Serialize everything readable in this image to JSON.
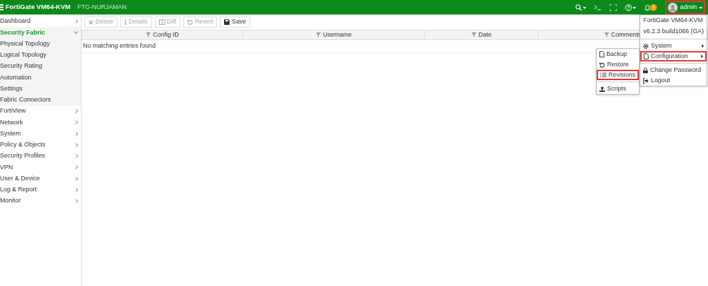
{
  "header": {
    "product": "FortiGate VM64-KVM",
    "hostname": "FTG-NURJAMAN",
    "notification_count": "1",
    "user": "admin",
    "user_highlighted": true
  },
  "sidebar": {
    "items": [
      {
        "label": "Dashboard",
        "expanded": false,
        "selected": false
      },
      {
        "label": "Security Fabric",
        "expanded": true,
        "selected": true,
        "children": [
          {
            "label": "Physical Topology"
          },
          {
            "label": "Logical Topology"
          },
          {
            "label": "Security Rating"
          },
          {
            "label": "Automation"
          },
          {
            "label": "Settings"
          },
          {
            "label": "Fabric Connectors"
          }
        ]
      },
      {
        "label": "FortiView",
        "expanded": false,
        "selected": false
      },
      {
        "label": "Network",
        "expanded": false,
        "selected": false
      },
      {
        "label": "System",
        "expanded": false,
        "selected": false
      },
      {
        "label": "Policy & Objects",
        "expanded": false,
        "selected": false
      },
      {
        "label": "Security Profiles",
        "expanded": false,
        "selected": false
      },
      {
        "label": "VPN",
        "expanded": false,
        "selected": false
      },
      {
        "label": "User & Device",
        "expanded": false,
        "selected": false
      },
      {
        "label": "Log & Report",
        "expanded": false,
        "selected": false
      },
      {
        "label": "Monitor",
        "expanded": false,
        "selected": false
      }
    ]
  },
  "toolbar": [
    {
      "kind": "delete",
      "label": "Delete",
      "disabled": true
    },
    {
      "kind": "details",
      "label": "Details",
      "disabled": true
    },
    {
      "kind": "diff",
      "label": "Diff",
      "disabled": true
    },
    {
      "kind": "revert",
      "label": "Revert",
      "disabled": true
    },
    {
      "kind": "save",
      "label": "Save",
      "disabled": false
    }
  ],
  "table": {
    "columns": [
      "Config ID",
      "Username",
      "Date",
      "Comments"
    ],
    "empty_message": "No matching entries found"
  },
  "user_menu": {
    "info": [
      "FortiGate VM64-KVM",
      "v6.2.3 build1066 (GA)"
    ],
    "items": [
      {
        "kind": "gear",
        "label": "System",
        "submenu": true,
        "highlighted": false
      },
      {
        "kind": "file",
        "label": "Configuration",
        "submenu": true,
        "highlighted": true
      },
      {
        "kind": "lock",
        "label": "Change Password",
        "submenu": false,
        "highlighted": false
      },
      {
        "kind": "logout",
        "label": "Logout",
        "submenu": false,
        "highlighted": false
      }
    ]
  },
  "config_menu": {
    "items": [
      {
        "kind": "file",
        "label": "Backup",
        "highlighted": false
      },
      {
        "kind": "restore",
        "label": "Restore",
        "highlighted": false
      },
      {
        "kind": "list",
        "label": "Revisions",
        "highlighted": true
      },
      {
        "kind": "upload",
        "label": "Scripts",
        "highlighted": false
      }
    ]
  }
}
